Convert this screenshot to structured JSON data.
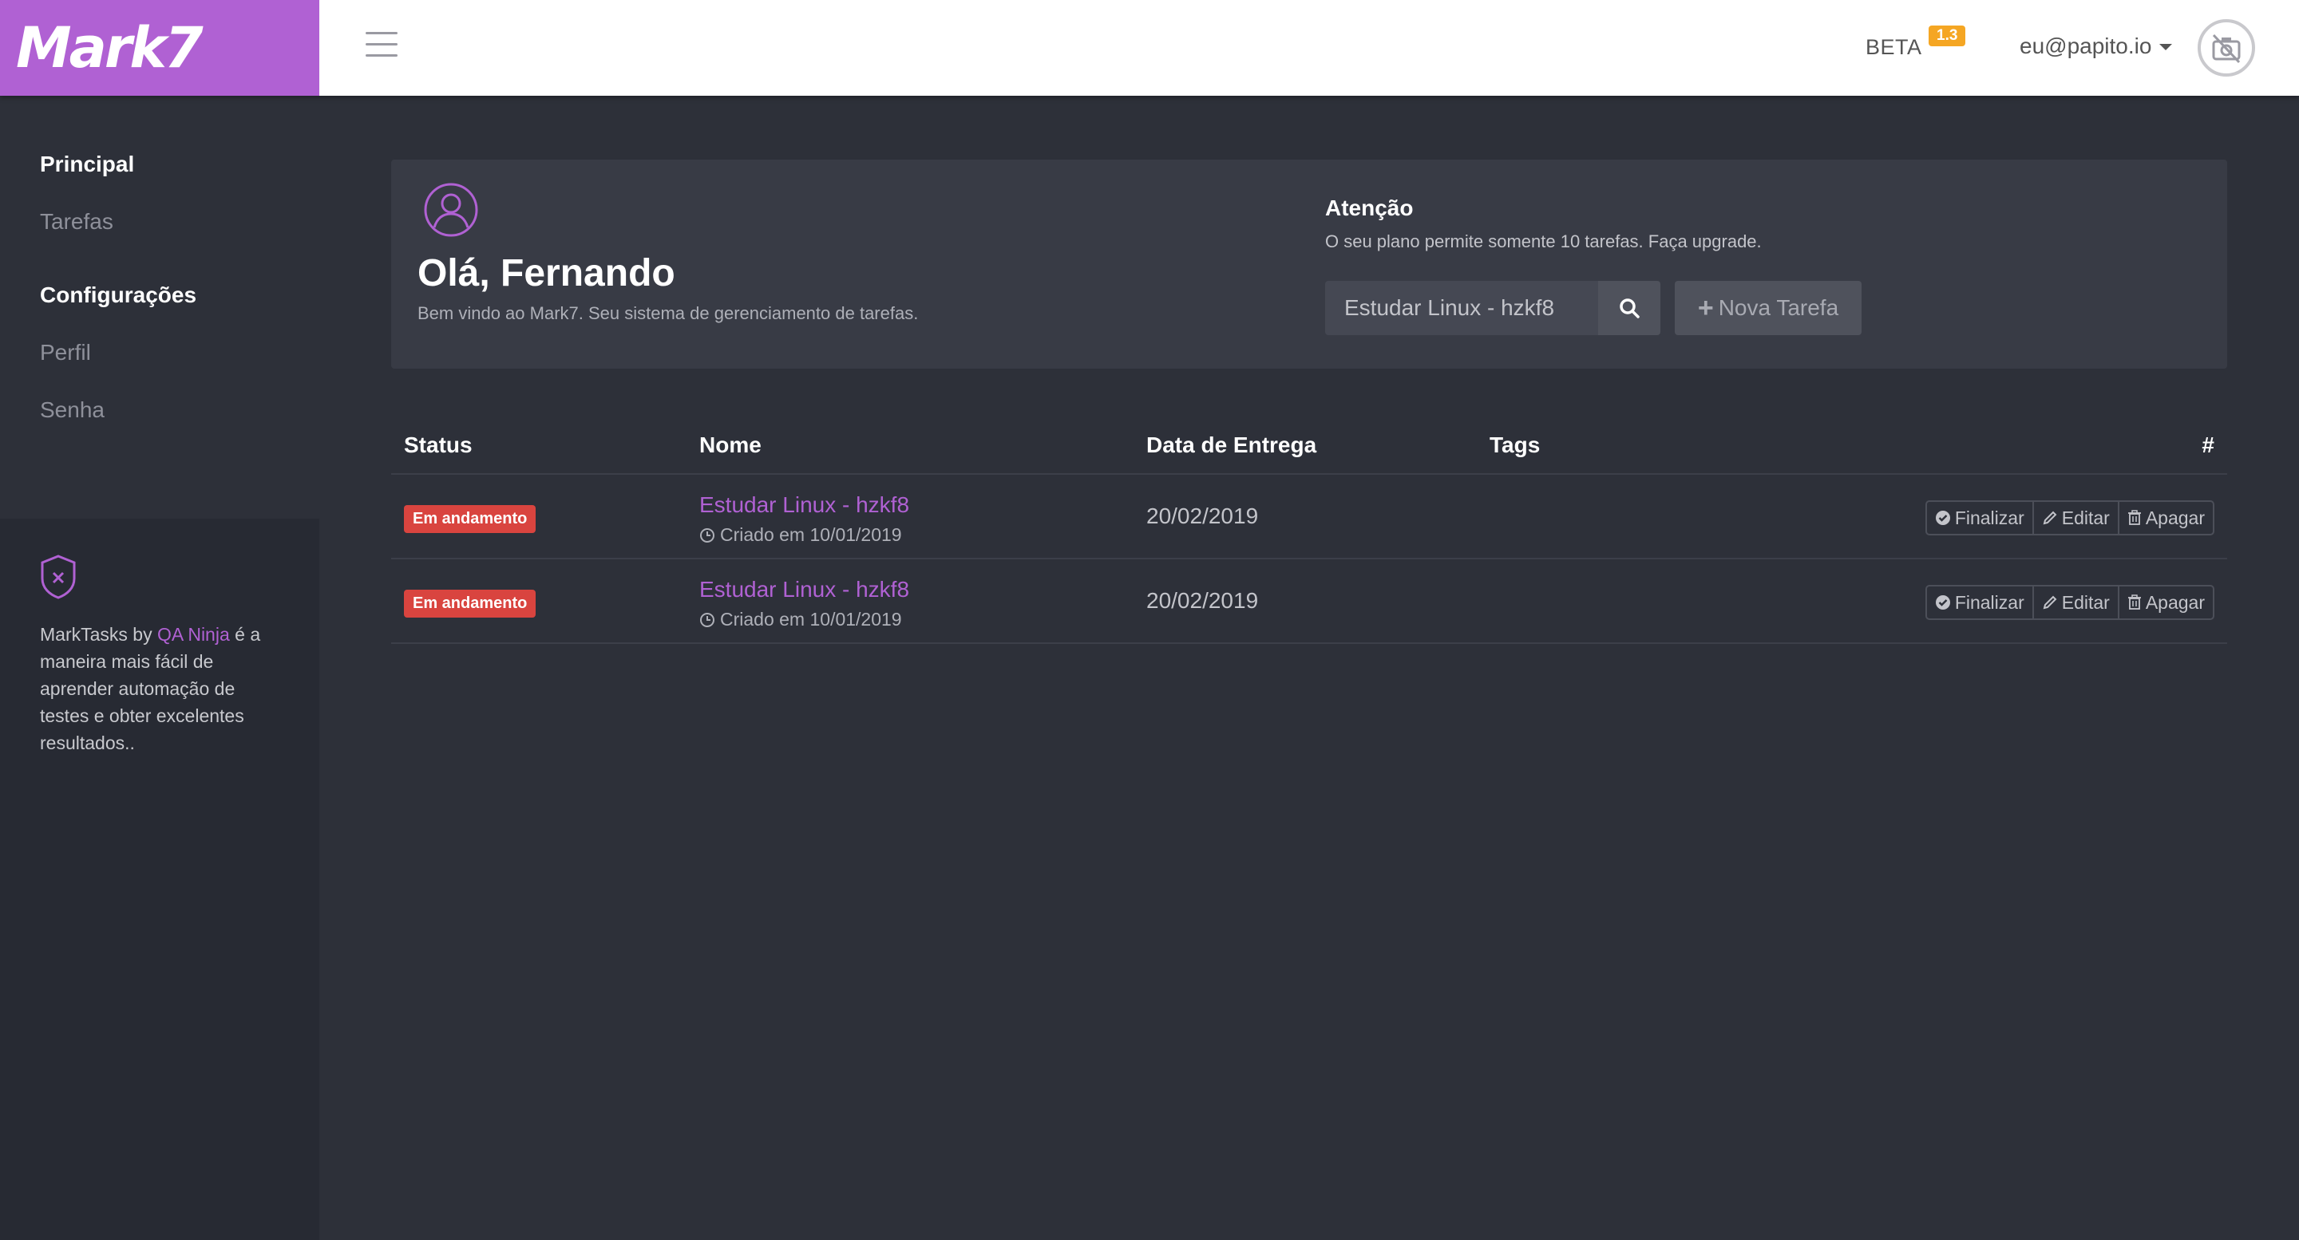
{
  "brand": {
    "logo_text": "Mark7",
    "accent": "#b061d3"
  },
  "header": {
    "beta_label": "BETA",
    "version": "1.3",
    "user_email": "eu@papito.io",
    "menu_icon": "hamburger-icon",
    "avatar_icon": "no-camera-icon"
  },
  "sidebar": {
    "sections": [
      {
        "header": "Principal",
        "items": [
          "Tarefas"
        ]
      },
      {
        "header": "Configurações",
        "items": [
          "Perfil",
          "Senha"
        ]
      }
    ],
    "promo": {
      "icon": "shield-icon",
      "prefix": "MarkTasks by ",
      "link": "QA Ninja",
      "suffix": " é a maneira mais fácil de aprender automação de testes e obter excelentes resultados.."
    }
  },
  "welcome": {
    "icon": "user-circle-icon",
    "greeting": "Olá, Fernando",
    "subtitle": "Bem vindo ao Mark7. Seu sistema de gerenciamento de tarefas.",
    "attention_title": "Atenção",
    "attention_text": "O seu plano permite somente 10 tarefas. Faça upgrade.",
    "search_value": "Estudar Linux - hzkf8",
    "search_icon": "search-icon",
    "new_task_label": "Nova Tarefa"
  },
  "table": {
    "columns": [
      "Status",
      "Nome",
      "Data de Entrega",
      "Tags",
      "#"
    ],
    "rows": [
      {
        "status": "Em andamento",
        "name": "Estudar Linux - hzkf8",
        "created": "Criado em 10/01/2019",
        "due": "20/02/2019",
        "actions": [
          "Finalizar",
          "Editar",
          "Apagar"
        ]
      },
      {
        "status": "Em andamento",
        "name": "Estudar Linux - hzkf8",
        "created": "Criado em 10/01/2019",
        "due": "20/02/2019",
        "actions": [
          "Finalizar",
          "Editar",
          "Apagar"
        ]
      }
    ]
  },
  "colors": {
    "status_badge": "#d9443f",
    "version_badge": "#f5a623",
    "background": "#2d3039",
    "panel": "#383b45"
  }
}
